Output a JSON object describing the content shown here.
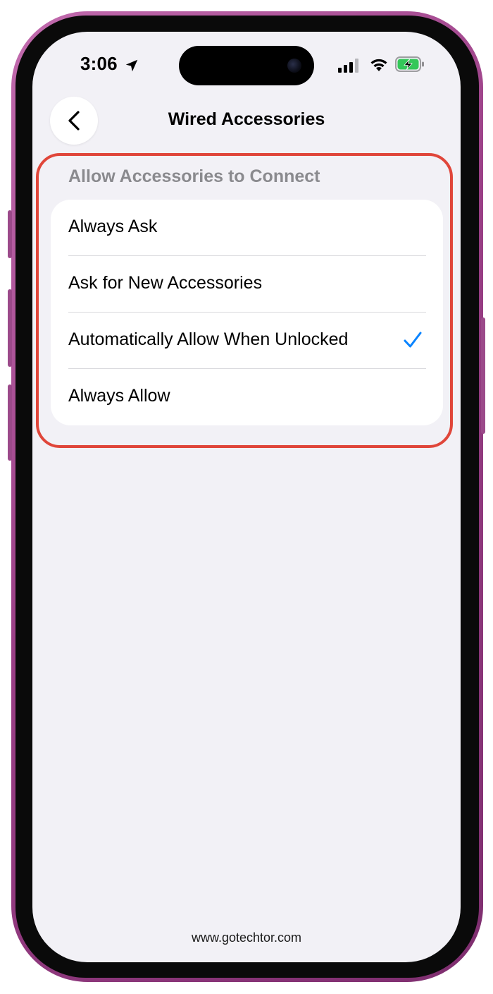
{
  "status_bar": {
    "time": "3:06",
    "location_icon": "location-arrow-icon",
    "signal_icon": "cellular-signal-icon",
    "wifi_icon": "wifi-icon",
    "battery_icon": "battery-charging-icon",
    "battery_color": "#34c759"
  },
  "nav": {
    "back_icon": "chevron-left-icon",
    "title": "Wired Accessories"
  },
  "section": {
    "header": "Allow Accessories to Connect",
    "options": [
      {
        "label": "Always Ask",
        "selected": false
      },
      {
        "label": "Ask for New Accessories",
        "selected": false
      },
      {
        "label": "Automatically Allow When Unlocked",
        "selected": true
      },
      {
        "label": "Always Allow",
        "selected": false
      }
    ]
  },
  "colors": {
    "accent": "#0a84ff",
    "highlight": "#e0463a",
    "background": "#f2f1f6",
    "frame": "#9a3f86"
  },
  "watermark": "www.gotechtor.com"
}
